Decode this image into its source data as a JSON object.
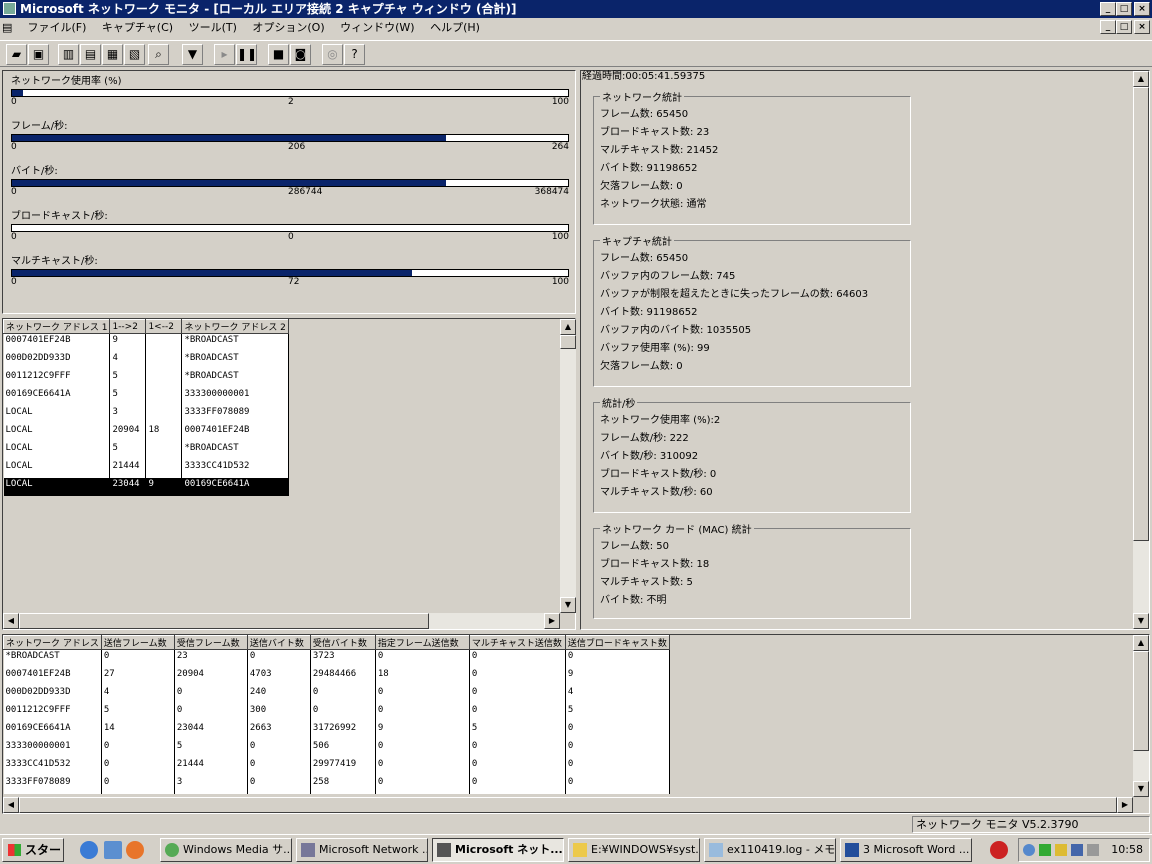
{
  "window": {
    "title": "Microsoft ネットワーク モニタ - [ローカル エリア接続 2 キャプチャ ウィンドウ (合計)]"
  },
  "menu": [
    "ファイル(F)",
    "キャプチャ(C)",
    "ツール(T)",
    "オプション(O)",
    "ウィンドウ(W)",
    "ヘルプ(H)"
  ],
  "graphs": [
    {
      "label": "ネットワーク使用率 (%)",
      "min": "0",
      "mid": "2",
      "max": "100",
      "level_percent": 2
    },
    {
      "label": "フレーム/秒:",
      "min": "0",
      "mid": "206",
      "max": "264",
      "level_percent": 78
    },
    {
      "label": "バイト/秒:",
      "min": "0",
      "mid": "286744",
      "max": "368474",
      "level_percent": 78
    },
    {
      "label": "ブロードキャスト/秒:",
      "min": "0",
      "mid": "0",
      "max": "100",
      "level_percent": 0
    },
    {
      "label": "マルチキャスト/秒:",
      "min": "0",
      "mid": "72",
      "max": "100",
      "level_percent": 72
    }
  ],
  "pairs": {
    "headers": [
      "ネットワーク アドレス 1",
      "1-->2",
      "1<--2",
      "ネットワーク アドレス 2"
    ],
    "rows": [
      [
        "0007401EF24B",
        "9",
        "",
        "*BROADCAST"
      ],
      [
        "000D02DD933D",
        "4",
        "",
        "*BROADCAST"
      ],
      [
        "0011212C9FFF",
        "5",
        "",
        "*BROADCAST"
      ],
      [
        "00169CE6641A",
        "5",
        "",
        "333300000001"
      ],
      [
        "LOCAL",
        "3",
        "",
        "3333FF078089"
      ],
      [
        "LOCAL",
        "20904",
        "18",
        "0007401EF24B"
      ],
      [
        "LOCAL",
        "5",
        "",
        "*BROADCAST"
      ],
      [
        "LOCAL",
        "21444",
        "",
        "3333CC41D532"
      ],
      [
        "LOCAL",
        "23044",
        "9",
        "00169CE6641A"
      ]
    ]
  },
  "stats": {
    "elapsed": "経過時間:00:05:41.59375",
    "groups": [
      {
        "title": "ネットワーク統計",
        "rows": [
          "フレーム数: 65450",
          "ブロードキャスト数: 23",
          "マルチキャスト数: 21452",
          "バイト数: 91198652",
          "欠落フレーム数: 0",
          "ネットワーク状態: 通常"
        ]
      },
      {
        "title": "キャプチャ統計",
        "rows": [
          "フレーム数: 65450",
          "バッファ内のフレーム数: 745",
          "バッファが制限を超えたときに失ったフレームの数: 64603",
          "バイト数: 91198652",
          "バッファ内のバイト数: 1035505",
          "バッファ使用率 (%): 99",
          "欠落フレーム数: 0"
        ]
      },
      {
        "title": "統計/秒",
        "rows": [
          "ネットワーク使用率 (%):2",
          "フレーム数/秒: 222",
          "バイト数/秒: 310092",
          "ブロードキャスト数/秒: 0",
          "マルチキャスト数/秒: 60"
        ]
      },
      {
        "title": "ネットワーク カード (MAC) 統計",
        "rows": [
          "フレーム数: 50",
          "ブロードキャスト数: 18",
          "マルチキャスト数: 5",
          "バイト数: 不明"
        ]
      }
    ]
  },
  "hosts": {
    "headers": [
      "ネットワーク アドレス",
      "送信フレーム数",
      "受信フレーム数",
      "送信バイト数",
      "受信バイト数",
      "指定フレーム送信数",
      "マルチキャスト送信数",
      "送信ブロードキャスト数"
    ],
    "rows": [
      [
        "*BROADCAST",
        "0",
        "23",
        "0",
        "3723",
        "0",
        "0",
        "0"
      ],
      [
        "0007401EF24B",
        "27",
        "20904",
        "4703",
        "29484466",
        "18",
        "0",
        "9"
      ],
      [
        "000D02DD933D",
        "4",
        "0",
        "240",
        "0",
        "0",
        "0",
        "4"
      ],
      [
        "0011212C9FFF",
        "5",
        "0",
        "300",
        "0",
        "0",
        "0",
        "5"
      ],
      [
        "00169CE6641A",
        "14",
        "23044",
        "2663",
        "31726992",
        "9",
        "5",
        "0"
      ],
      [
        "333300000001",
        "0",
        "5",
        "0",
        "506",
        "0",
        "0",
        "0"
      ],
      [
        "3333CC41D532",
        "0",
        "21444",
        "0",
        "29977419",
        "0",
        "0",
        "0"
      ],
      [
        "3333FF078089",
        "0",
        "3",
        "0",
        "258",
        "0",
        "0",
        "0"
      ]
    ]
  },
  "status": {
    "text": "ネットワーク モニタ V5.2.3790"
  },
  "taskbar": {
    "start": "スタート",
    "tasks": [
      "Windows Media サ...",
      "Microsoft Network ...",
      "Microsoft ネット...",
      "E:¥WINDOWS¥syst...",
      "ex110419.log - メモ...",
      "3 Microsoft Word ..."
    ],
    "clock": "10:58"
  }
}
